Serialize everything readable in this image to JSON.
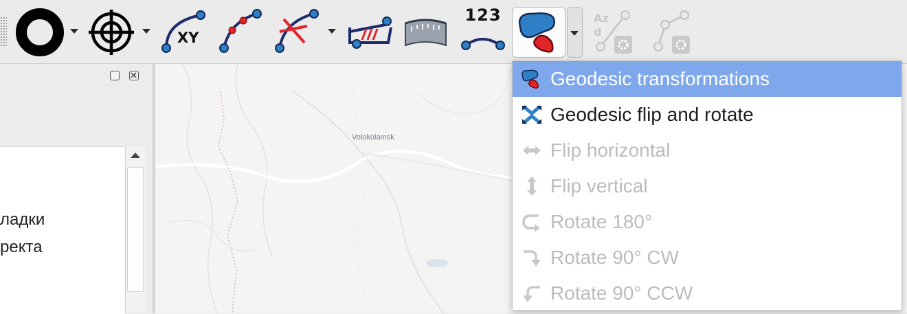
{
  "toolbar": {
    "tools": [
      {
        "name": "ring-buffer-icon"
      },
      {
        "name": "crosshair-point-icon"
      },
      {
        "name": "geodesic-line-xy-icon",
        "label": "XY"
      },
      {
        "name": "geodesic-densify-icon"
      },
      {
        "name": "geodesic-line-break-icon"
      },
      {
        "name": "geodesic-shape-break-icon"
      },
      {
        "name": "geodesic-measure-icon"
      },
      {
        "name": "geodesic-line-attributes-icon",
        "label": "123"
      },
      {
        "name": "geodesic-transformations-icon"
      },
      {
        "name": "azimuth-distance-icon",
        "label_az": "Az",
        "label_d": "d"
      },
      {
        "name": "line-settings-icon"
      }
    ]
  },
  "map": {
    "city_label": "Volokolamsk",
    "colors": {
      "land": "#f4f4f3",
      "water": "#dbe2e8",
      "road": "#ffffff",
      "border": "#d7b3b3"
    }
  },
  "left_panel": {
    "lines": [
      "ладки",
      "ректа"
    ]
  },
  "menu": {
    "items": [
      {
        "label": "Geodesic transformations",
        "icon": "geodesic-transformations-icon",
        "state": "active"
      },
      {
        "label": "Geodesic flip and rotate",
        "icon": "flip-rotate-icon",
        "state": "enabled"
      },
      {
        "label": "Flip horizontal",
        "icon": "flip-horizontal-icon",
        "state": "disabled"
      },
      {
        "label": "Flip vertical",
        "icon": "flip-vertical-icon",
        "state": "disabled"
      },
      {
        "label": "Rotate 180°",
        "icon": "rotate-180-icon",
        "state": "disabled"
      },
      {
        "label": "Rotate 90° CW",
        "icon": "rotate-cw-icon",
        "state": "disabled"
      },
      {
        "label": "Rotate 90° CCW",
        "icon": "rotate-ccw-icon",
        "state": "disabled"
      }
    ],
    "colors": {
      "highlight": "#7fa7ec",
      "disabled_text": "#bcbcbc"
    }
  }
}
